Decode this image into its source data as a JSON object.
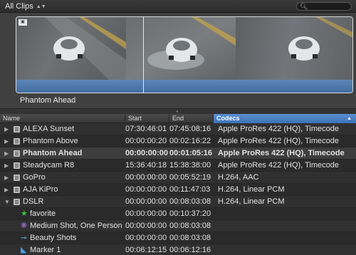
{
  "toolbar": {
    "clips_filter": "All Clips"
  },
  "viewer": {
    "clip_title": "Phantom Ahead"
  },
  "columns": {
    "name": "Name",
    "start": "Start",
    "end": "End",
    "codecs": "Codecs"
  },
  "rows": [
    {
      "name": "ALEXA Sunset",
      "start": "07:30:46:01",
      "end": "07:45:08:16",
      "codecs": "Apple ProRes 422 (HQ), Timecode",
      "icon": "clip-icon"
    },
    {
      "name": "Phantom Above",
      "start": "00:00:00:20",
      "end": "00:02:16:22",
      "codecs": "Apple ProRes 422 (HQ), Timecode",
      "icon": "clip-icon"
    },
    {
      "name": "Phantom Ahead",
      "start": "00:00:00:00",
      "end": "00:01:05:16",
      "codecs": "Apple ProRes 422 (HQ), Timecode",
      "icon": "clip-icon-selected"
    },
    {
      "name": "Steadycam R8",
      "start": "15:36:40:18",
      "end": "15:38:38:00",
      "codecs": "Apple ProRes 422 (HQ), Timecode",
      "icon": "clip-icon"
    },
    {
      "name": "GoPro",
      "start": "00:00:00:00",
      "end": "00:05:52:19",
      "codecs": "H.264, AAC",
      "icon": "clip-icon"
    },
    {
      "name": "AJA KiPro",
      "start": "00:00:00:00",
      "end": "00:11:47:03",
      "codecs": "H.264, Linear PCM",
      "icon": "clip-icon"
    },
    {
      "name": "DSLR",
      "start": "00:00:00:00",
      "end": "00:08:03:08",
      "codecs": "H.264, Linear PCM",
      "icon": "clip-icon"
    },
    {
      "name": "favorite",
      "start": "00:00:00:00",
      "end": "00:10:37:20",
      "codecs": "",
      "icon": "favorite-star-icon"
    },
    {
      "name": "Medium Shot, One Person",
      "start": "00:00:00:00",
      "end": "00:08:03:08",
      "codecs": "",
      "icon": "analysis-keyword-icon"
    },
    {
      "name": "Beauty Shots",
      "start": "00:00:00:00",
      "end": "00:08:03:08",
      "codecs": "",
      "icon": "keyword-icon"
    },
    {
      "name": "Marker 1",
      "start": "00:06:12:15",
      "end": "00:06:12:16",
      "codecs": "",
      "icon": "marker-icon"
    }
  ],
  "colors": {
    "accent": "#4a80c8",
    "waveform": "#4f7bb0",
    "favorite": "#3fbf3f",
    "keyword": "#6fc9e8",
    "analysis": "#9a7ad8",
    "marker": "#4aa0e8"
  }
}
